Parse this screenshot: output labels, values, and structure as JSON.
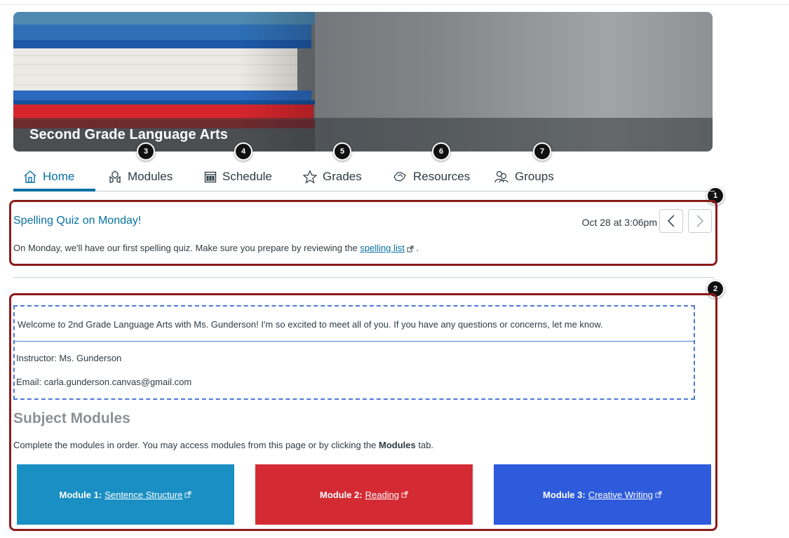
{
  "course": {
    "title": "Second Grade Language Arts"
  },
  "nav": {
    "tabs": [
      {
        "label": "Home",
        "icon": "home-icon",
        "active": true
      },
      {
        "label": "Modules",
        "icon": "modules-icon"
      },
      {
        "label": "Schedule",
        "icon": "calendar-icon"
      },
      {
        "label": "Grades",
        "icon": "star-icon"
      },
      {
        "label": "Resources",
        "icon": "resources-icon"
      },
      {
        "label": "Groups",
        "icon": "groups-icon"
      }
    ]
  },
  "callouts": [
    "1",
    "2",
    "3",
    "4",
    "5",
    "6",
    "7"
  ],
  "announcement": {
    "title": "Spelling Quiz on Monday!",
    "date": "Oct 28 at 3:06pm",
    "body_prefix": "On Monday, we'll have our first spelling quiz. Make sure you prepare by reviewing the ",
    "link_text": "spelling list",
    "body_suffix": "."
  },
  "welcome": {
    "text": "Welcome to 2nd Grade Language Arts with Ms. Gunderson! I'm so excited to meet all of you. If you have any questions or concerns, let me know.",
    "instructor": "Instructor: Ms. Gunderson",
    "email": "Email: carla.gunderson.canvas@gmail.com"
  },
  "subject": {
    "heading": "Subject Modules",
    "desc_prefix": "Complete the modules in order. You may access modules from this page or by clicking the ",
    "desc_bold": "Modules",
    "desc_suffix": " tab."
  },
  "modules": [
    {
      "prefix": "Module 1:",
      "link": "Sentence Structure",
      "color": "#1a8fc3"
    },
    {
      "prefix": "Module 2:",
      "link": "Reading",
      "color": "#d42a34"
    },
    {
      "prefix": "Module 3:",
      "link": "Creative Writing",
      "color": "#2d5bdb"
    }
  ],
  "colors": {
    "accent": "#0770a3",
    "highlight": "#8b1a1a",
    "dashed": "#4c7ad6"
  }
}
